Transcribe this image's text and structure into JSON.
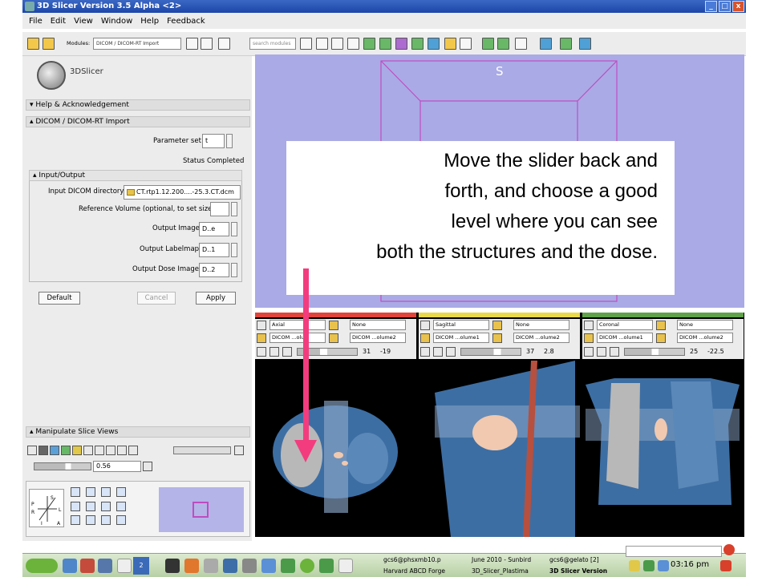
{
  "window": {
    "title": "3D Slicer Version 3.5 Alpha <2>",
    "minimize": "_",
    "maximize": "□",
    "close": "x"
  },
  "menu": [
    "File",
    "Edit",
    "View",
    "Window",
    "Help",
    "Feedback"
  ],
  "toolbar": {
    "modules_label": "Modules:",
    "module_value": "DICOM / DICOM-RT Import",
    "search_placeholder": "search modules"
  },
  "logo_text": "3DSlicer",
  "sections": {
    "help": "Help & Acknowledgement",
    "module": "DICOM / DICOM-RT Import",
    "io": "Input/Output",
    "manipulate": "Manipulate Slice Views"
  },
  "params": {
    "parameter_set_label": "Parameter set",
    "parameter_set_value": "t",
    "status_label": "Status",
    "status_value": "Completed"
  },
  "io": {
    "dicom_dir_label": "Input DICOM directory",
    "dicom_dir_value": "CT.rtp1.12.200....-25.3.CT.dcm",
    "ref_label": "Reference Volume (optional, to set size)",
    "out_image_label": "Output Image",
    "out_image_value": "D..e",
    "out_label_label": "Output Labelmap",
    "out_label_value": "D..1",
    "out_dose_label": "Output Dose Image",
    "out_dose_value": "D..2"
  },
  "buttons": {
    "default": "Default",
    "cancel": "Cancel",
    "apply": "Apply"
  },
  "manipulate_value": "0.56",
  "viewer3d_label": "S",
  "callout_lines": [
    "Move the slider back and",
    "forth, and choose a good",
    "level where you can see",
    "both the structures and the dose."
  ],
  "slices": [
    {
      "orientation": "Axial",
      "fg": "None",
      "bg": "DICOM ...olu",
      "label": "DICOM ...olume2",
      "index": "31",
      "offset": "-19",
      "color": "#e0443b",
      "slider": 0.38
    },
    {
      "orientation": "Sagittal",
      "fg": "None",
      "bg": "DICOM ...olume1",
      "label": "DICOM ...olume2",
      "index": "37",
      "offset": "2.8",
      "color": "#e8d84a",
      "slider": 0.55
    },
    {
      "orientation": "Coronal",
      "fg": "None",
      "bg": "DICOM ...olume1",
      "label": "DICOM ...olume2",
      "index": "25",
      "offset": "-22.5",
      "color": "#5fa24a",
      "slider": 0.45
    }
  ],
  "taskbar": {
    "desktop_number": "2",
    "items": [
      "gcs6@phsxmb10.p",
      "June 2010 - Sunbird",
      "gcs6@gelato [2]",
      "Harvard ABCD Forge",
      "3D_Slicer_Plastima",
      "3D Slicer Version"
    ],
    "clock": "03:16 pm"
  }
}
